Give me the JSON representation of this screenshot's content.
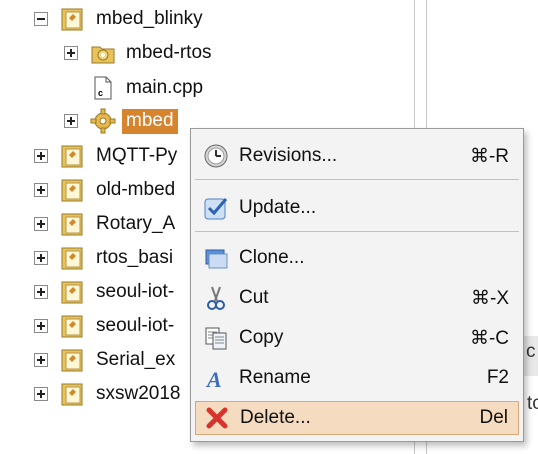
{
  "tree": {
    "items": [
      {
        "label": "mbed_blinky",
        "toggle": "minus",
        "icon": "program-folder-icon"
      },
      {
        "label": "mbed-rtos",
        "toggle": "plus",
        "icon": "library-folder-icon"
      },
      {
        "label": "main.cpp",
        "toggle": "none",
        "icon": "cpp-file-icon"
      },
      {
        "label": "mbed",
        "toggle": "plus",
        "icon": "gear-library-icon",
        "selected": true
      },
      {
        "label": "MQTT-Py",
        "toggle": "plus",
        "icon": "program-folder-icon"
      },
      {
        "label": "old-mbed",
        "toggle": "plus",
        "icon": "program-folder-icon"
      },
      {
        "label": "Rotary_A",
        "toggle": "plus",
        "icon": "program-folder-icon"
      },
      {
        "label": "rtos_basi",
        "toggle": "plus",
        "icon": "program-folder-icon"
      },
      {
        "label": "seoul-iot-",
        "toggle": "plus",
        "icon": "program-folder-icon"
      },
      {
        "label": "seoul-iot-",
        "toggle": "plus",
        "icon": "program-folder-icon"
      },
      {
        "label": "Serial_ex",
        "toggle": "plus",
        "icon": "program-folder-icon"
      },
      {
        "label": "sxsw2018",
        "toggle": "plus",
        "icon": "program-folder-icon"
      }
    ]
  },
  "menu": {
    "items": [
      {
        "label": "Revisions...",
        "shortcut": "⌘-R",
        "icon": "clock-icon"
      },
      {
        "label": "Update...",
        "shortcut": "",
        "icon": "checkbox-check-icon"
      },
      {
        "label": "Clone...",
        "shortcut": "",
        "icon": "clone-window-icon"
      },
      {
        "label": "Cut",
        "shortcut": "⌘-X",
        "icon": "scissors-icon"
      },
      {
        "label": "Copy",
        "shortcut": "⌘-C",
        "icon": "copy-documents-icon"
      },
      {
        "label": "Rename",
        "shortcut": "F2",
        "icon": "letter-a-icon"
      },
      {
        "label": "Delete...",
        "shortcut": "Del",
        "icon": "red-x-icon",
        "active": true
      }
    ]
  },
  "background_panel": {
    "fragment_1": "c",
    "fragment_2": "tc"
  },
  "colors": {
    "selection": "#d7842f",
    "menu_highlight": "#f5dcc0",
    "folder_yellow": "#e7c35a"
  }
}
